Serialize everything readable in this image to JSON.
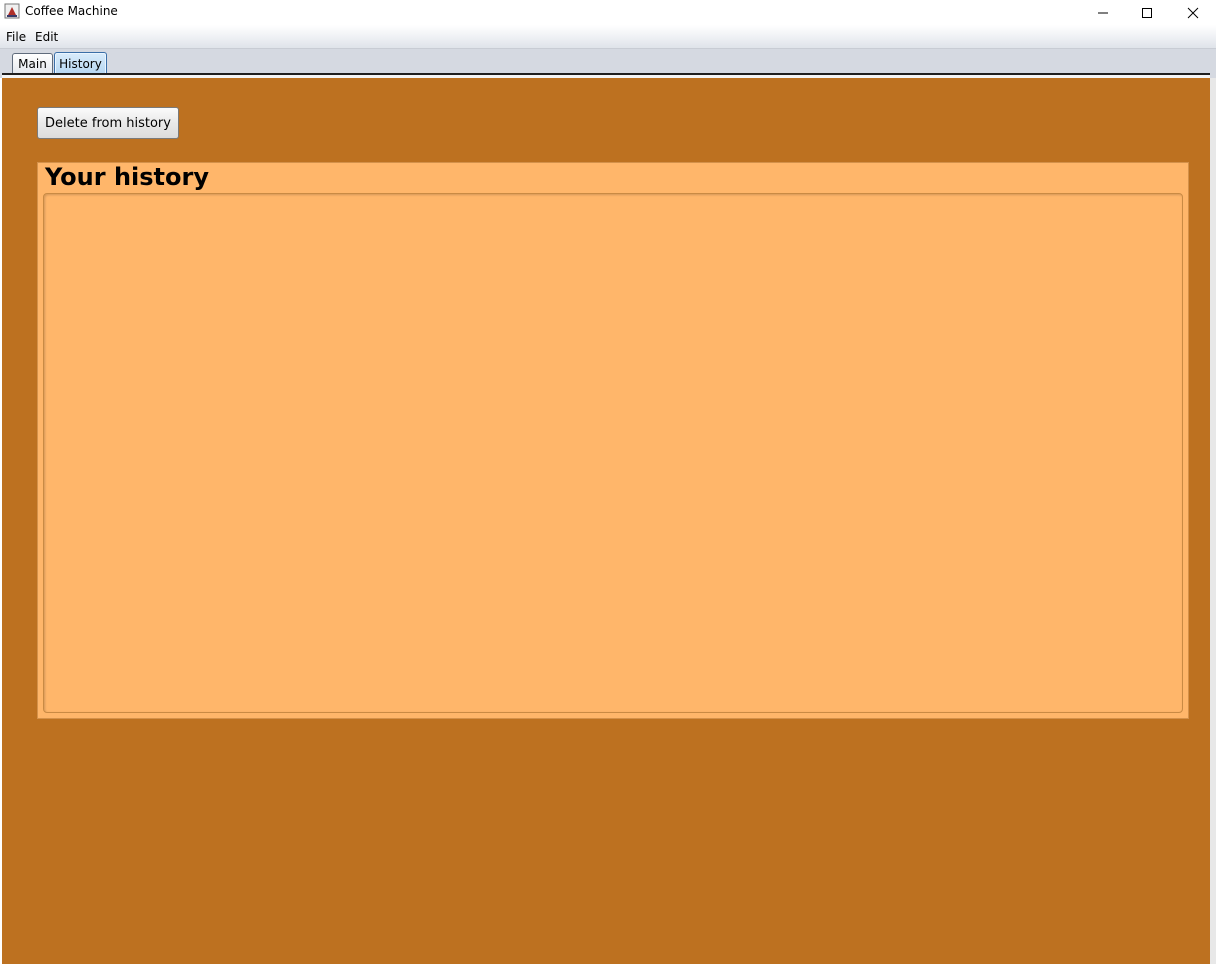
{
  "window": {
    "title": "Coffee Machine",
    "icon": "java-cup-icon"
  },
  "menu": {
    "items": [
      {
        "label": "File"
      },
      {
        "label": "Edit"
      }
    ]
  },
  "tabs": [
    {
      "label": "Main",
      "selected": false
    },
    {
      "label": "History",
      "selected": true
    }
  ],
  "history_tab": {
    "delete_button_label": "Delete from history",
    "panel_title": "Your history",
    "entries": []
  },
  "colors": {
    "content_background": "#bd7120",
    "panel_background": "#ffb66a",
    "selected_tab": "#b6d6f1"
  }
}
